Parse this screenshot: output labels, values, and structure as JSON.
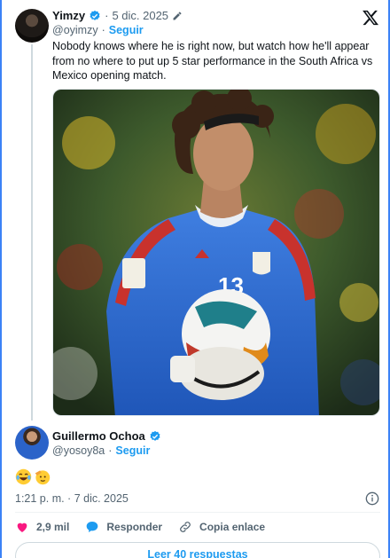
{
  "tweet": {
    "author_name": "Yimzy",
    "date": "5 dic. 2025",
    "handle": "@oyimzy",
    "follow_label": "Seguir",
    "text": "Nobody knows where he is right now, but watch how he'll appear from no where to put up 5 star performance in the South Africa vs Mexico opening match.",
    "jersey_number": "13"
  },
  "reply": {
    "author_name": "Guillermo Ochoa",
    "handle": "@yosoy8a",
    "follow_label": "Seguir",
    "emojis": [
      "laughing-tears",
      "saluting-face"
    ],
    "timestamp": "1:21 p. m. · 7 dic. 2025"
  },
  "actions": {
    "likes": "2,9 mil",
    "reply_label": "Responder",
    "copy_label": "Copia enlace"
  },
  "read_more_label": "Leer 40 respuestas",
  "separator": "·",
  "colors": {
    "accent": "#1d9bf0",
    "like": "#f91880",
    "muted": "#536471"
  }
}
